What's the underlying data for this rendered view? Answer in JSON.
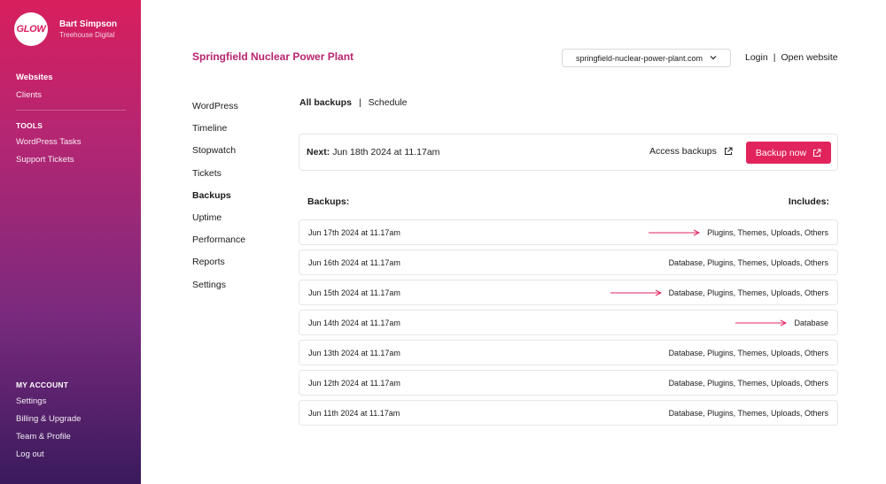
{
  "sidebar": {
    "logo_text": "GLOW",
    "user_name": "Bart Simpson",
    "user_org": "Treehouse Digital",
    "main_items": [
      {
        "label": "Websites",
        "active": true
      },
      {
        "label": "Clients",
        "active": false
      }
    ],
    "tools_title": "TOOLS",
    "tools_items": [
      {
        "label": "WordPress Tasks"
      },
      {
        "label": "Support Tickets"
      }
    ],
    "account_title": "MY ACCOUNT",
    "account_items": [
      {
        "label": "Settings"
      },
      {
        "label": "Billing & Upgrade"
      },
      {
        "label": "Team & Profile"
      },
      {
        "label": "Log out"
      }
    ]
  },
  "header": {
    "site_title": "Springfield Nuclear Power Plant",
    "domain": "springfield-nuclear-power-plant.com",
    "login_label": "Login",
    "separator": "|",
    "open_website_label": "Open website"
  },
  "subnav": [
    {
      "label": "WordPress",
      "active": false
    },
    {
      "label": "Timeline",
      "active": false
    },
    {
      "label": "Stopwatch",
      "active": false
    },
    {
      "label": "Tickets",
      "active": false
    },
    {
      "label": "Backups",
      "active": true
    },
    {
      "label": "Uptime",
      "active": false
    },
    {
      "label": "Performance",
      "active": false
    },
    {
      "label": "Reports",
      "active": false
    },
    {
      "label": "Settings",
      "active": false
    }
  ],
  "tabs": {
    "all_backups": "All backups",
    "separator": "|",
    "schedule": "Schedule"
  },
  "next_backup": {
    "label": "Next:",
    "value": "Jun 18th 2024 at 11.17am",
    "access_label": "Access backups",
    "backup_now_label": "Backup now"
  },
  "list": {
    "header_left": "Backups:",
    "header_right": "Includes:",
    "rows": [
      {
        "date": "Jun 17th 2024 at 11.17am",
        "includes": "Plugins, Themes, Uploads, Others",
        "arrow": true
      },
      {
        "date": "Jun 16th 2024 at 11.17am",
        "includes": "Database, Plugins, Themes, Uploads, Others",
        "arrow": false
      },
      {
        "date": "Jun 15th 2024 at 11.17am",
        "includes": "Database, Plugins, Themes, Uploads, Others",
        "arrow": true
      },
      {
        "date": "Jun 14th 2024 at 11.17am",
        "includes": "Database",
        "arrow": true
      },
      {
        "date": "Jun 13th 2024 at 11.17am",
        "includes": "Database, Plugins, Themes, Uploads, Others",
        "arrow": false
      },
      {
        "date": "Jun 12th 2024 at 11.17am",
        "includes": "Database, Plugins, Themes, Uploads, Others",
        "arrow": false
      },
      {
        "date": "Jun 11th 2024 at 11.17am",
        "includes": "Database, Plugins, Themes, Uploads, Others",
        "arrow": false
      }
    ]
  },
  "colors": {
    "accent": "#e1245c",
    "title": "#b8246f",
    "arrow": "#e1245c"
  },
  "icons": {
    "external": "external-link-icon",
    "chevron": "chevron-down-icon",
    "arrow": "arrow-right-icon"
  }
}
